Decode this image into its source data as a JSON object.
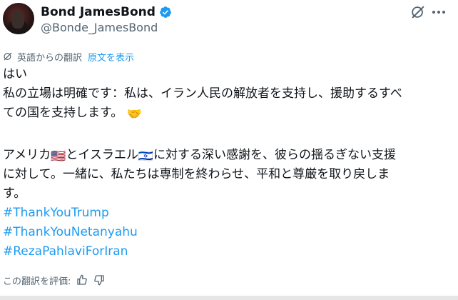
{
  "author": {
    "display_name": "Bond JamesBond",
    "handle": "@Bonde_JamesBond",
    "verified": true
  },
  "icons": {
    "verified": "verified-badge-icon",
    "grok": "grok-icon",
    "more": "more-options-icon",
    "translate": "translate-icon",
    "thumbs_up": "thumbs-up-icon",
    "thumbs_down": "thumbs-down-icon"
  },
  "translation": {
    "label": "英語からの翻訳",
    "show_original": "原文を表示"
  },
  "post": {
    "line1": "はい",
    "line2": "私の立場は明確です：私は、イラン人民の解放者を支持し、援助するすべ",
    "line3a": "ての国を支持します。",
    "line3_emoji": "🤝",
    "line4a": "アメリカ",
    "flag_us": "🇺🇸",
    "line4b": "とイスラエル",
    "flag_il": "🇮🇱",
    "line4c": "に対する深い感謝を、彼らの揺るぎない支援",
    "line5": "に対して。一緒に、私たちは専制を終わらせ、平和と尊厳を取り戻しま",
    "line6": "す。",
    "hashtags": [
      "#ThankYouTrump",
      "#ThankYouNetanyahu",
      "#RezaPahlaviForIran"
    ]
  },
  "rating": {
    "label": "この翻訳を評価:"
  },
  "colors": {
    "link": "#1d9bf0",
    "secondary": "#536471",
    "text": "#0f1419"
  }
}
